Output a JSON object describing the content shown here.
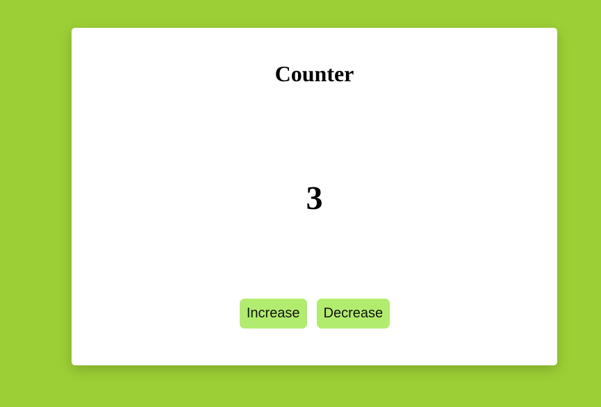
{
  "app": {
    "title": "Counter",
    "count": "3",
    "buttons": {
      "increase_label": "Increase",
      "decrease_label": "Decrease"
    }
  },
  "colors": {
    "background": "#9ccf35",
    "card": "#ffffff",
    "button": "#b2ec6e",
    "text": "#000000"
  }
}
